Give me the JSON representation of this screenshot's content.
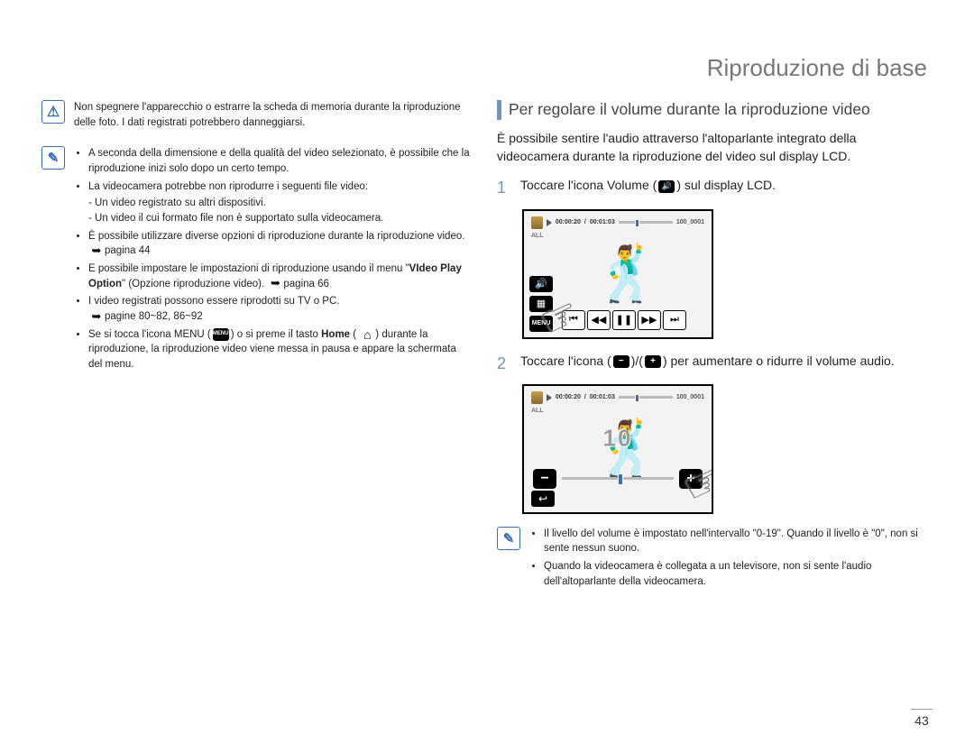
{
  "header": {
    "title": "Riproduzione di base"
  },
  "left": {
    "warning_text": "Non spegnere l'apparecchio o estrarre la scheda di memoria durante la riproduzione delle foto. I dati registrati potrebbero danneggiarsi.",
    "notes": {
      "b1": "A seconda della dimensione e della qualità del video selezionato, è possibile che la riproduzione inizi solo dopo un certo tempo.",
      "b2": "La videocamera potrebbe non riprodurre i seguenti file video:",
      "b2a": "Un video registrato su altri dispositivi.",
      "b2b": "Un video il cui formato file non è supportato sulla videocamera.",
      "b3a": "È possibile utilizzare diverse opzioni di riproduzione durante la riproduzione video. ",
      "b3_ref": "pagina 44",
      "b4a": "E possibile impostare le impostazioni di riproduzione usando il menu \"",
      "b4_bold": "VIdeo Play Option",
      "b4b": "\" (Opzione riproduzione video). ",
      "b4_ref": "pagina 66",
      "b5a": "I video registrati possono essere riprodotti su TV o PC.",
      "b5_ref": "pagine 80~82, 86~92",
      "b6a": "Se si tocca l'icona MENU (",
      "b6_menu": "MENU",
      "b6b": ") o si preme il tasto ",
      "b6_bold": "Home",
      "b6c": " ( ",
      "b6d": ") durante la riproduzione, la riproduzione video viene messa in pausa e appare la schermata del menu."
    }
  },
  "right": {
    "section_title": "Per regolare il volume durante la riproduzione video",
    "intro": "È possibile sentire l'audio attraverso l'altoparlante integrato della videocamera durante la riproduzione del video sul display LCD.",
    "step1": {
      "num": "1",
      "a": "Toccare l'icona Volume (",
      "b": ") sul display LCD."
    },
    "step2": {
      "num": "2",
      "a": "Toccare l'icona (",
      "mid": ")/(",
      "b": ") per aumentare o ridurre il volume audio."
    },
    "lcd": {
      "time_a": "00:00:20",
      "time_b": "00:01:03",
      "clip": "100_0001",
      "all": "ALL",
      "menu": "MENU",
      "level": "10"
    },
    "bottom_notes": {
      "n1": "Il livello del volume è impostato nell'intervallo \"0-19\". Quando il livello è \"0\", non si sente nessun suono.",
      "n2": "Quando la videocamera è collegata a un televisore, non si sente l'audio dell'altoparlante della videocamera."
    }
  },
  "page_number": "43"
}
